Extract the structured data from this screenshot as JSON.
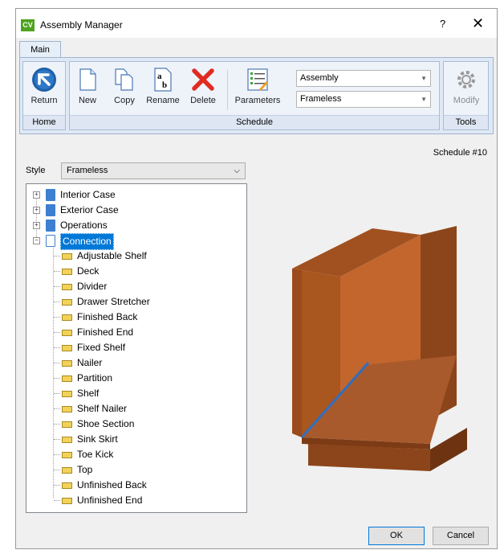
{
  "window": {
    "title": "Assembly Manager",
    "logo_text": "CV",
    "help": "?",
    "close": "✕"
  },
  "ribbon": {
    "tab": "Main",
    "groups": {
      "home": "Home",
      "schedule": "Schedule",
      "tools": "Tools"
    },
    "buttons": {
      "return": "Return",
      "new": "New",
      "copy": "Copy",
      "rename": "Rename",
      "delete": "Delete",
      "parameters": "Parameters",
      "modify": "Modify"
    },
    "assembly_combo": "Assembly",
    "style_combo": "Frameless"
  },
  "schedule_label": "Schedule #10",
  "style": {
    "label": "Style",
    "value": "Frameless"
  },
  "tree": {
    "groups": [
      "Interior Case",
      "Exterior Case",
      "Operations",
      "Connection"
    ],
    "connection_items": [
      "Adjustable Shelf",
      "Deck",
      "Divider",
      "Drawer Stretcher",
      "Finished Back",
      "Finished End",
      "Fixed Shelf",
      "Nailer",
      "Partition",
      "Shelf",
      "Shelf Nailer",
      "Shoe Section",
      "Sink Skirt",
      "Toe Kick",
      "Top",
      "Unfinished Back",
      "Unfinished End"
    ]
  },
  "footer": {
    "ok": "OK",
    "cancel": "Cancel"
  }
}
